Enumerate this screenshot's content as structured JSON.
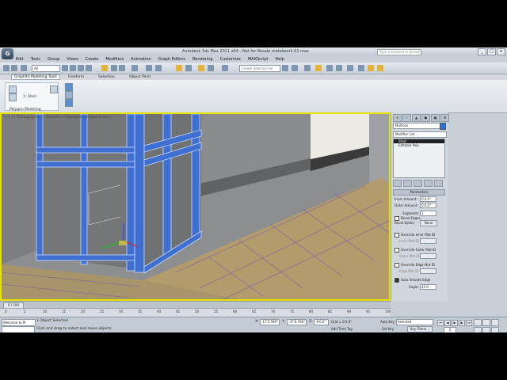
{
  "window": {
    "app_letter": "G",
    "title": "Autodesk 3ds Max 2011 x64 - Not for Resale   metalwork-01.max",
    "search_placeholder": "Type a keyword or phrase",
    "controls": [
      "_",
      "□",
      "×"
    ]
  },
  "menu": [
    "Edit",
    "Tools",
    "Group",
    "Views",
    "Create",
    "Modifiers",
    "Animation",
    "Graph Editors",
    "Rendering",
    "Customize",
    "MAXScript",
    "Help"
  ],
  "toolbar": {
    "selection_filter": "All",
    "named_selection": "Create Selection Se"
  },
  "ribbon": {
    "tabs": [
      "Graphite Modeling Tools",
      "Freeform",
      "Selection",
      "Object Paint"
    ],
    "panel_label": "1: Shell",
    "panel_title": "Polygon Modeling"
  },
  "viewport": {
    "label": "[ + ] [ Orthographic ] [ Smooth + Highlight + Edged Faces ]"
  },
  "command_panel": {
    "tabs": [
      "+",
      "◠",
      "▲",
      "●",
      "▣",
      "⚒"
    ],
    "object_name": "Mullions",
    "color": "#2d6fd6",
    "modifier_list": "Modifier List",
    "stack": [
      "Shell",
      "Editable Poly"
    ],
    "rollout": "Parameters",
    "params": {
      "inner_amount_label": "Inner Amount:",
      "inner_amount": "0'4.0\"",
      "outer_amount_label": "Outer Amount:",
      "outer_amount": "0'4.0\"",
      "segments_label": "Segments:",
      "segments": "1",
      "bevel_edges": "Bevel Edges",
      "bevel_spline_label": "Bevel Spline:",
      "bevel_spline": "None",
      "override_inner": "Override Inner Mat ID",
      "inner_mat_label": "Inner Mat ID:",
      "override_outer": "Override Outer Mat ID",
      "outer_mat_label": "Outer Mat ID:",
      "override_edge": "Override Edge Mat ID",
      "edge_mat_label": "Edge Mat ID:",
      "auto_smooth_edge": "Auto Smooth Edge",
      "angle_label": "Angle:",
      "angle": "45.0"
    }
  },
  "timeline": {
    "slider": "0 / 100",
    "ticks": [
      "0",
      "5",
      "10",
      "15",
      "20",
      "25",
      "30",
      "35",
      "40",
      "45",
      "50",
      "55",
      "60",
      "65",
      "70",
      "75",
      "80",
      "85",
      "90",
      "95",
      "100"
    ]
  },
  "status": {
    "maxscript": "Welcome to M",
    "selected": "1 Object Selected",
    "prompt": "Click and drag to select and move objects",
    "x_label": "X:",
    "x": "-17'2.599\"",
    "y_label": "Y:",
    "y": "-37'6.766\"",
    "z_label": "Z:",
    "z": "-0'0.0\"",
    "grid": "Grid = 0'1.0\"",
    "add_time_tag": "Add Time Tag",
    "auto_key": "Auto Key",
    "key_mode": "Selected",
    "set_key": "Set Key",
    "key_filters": "Key Filters...",
    "frame": "0"
  }
}
